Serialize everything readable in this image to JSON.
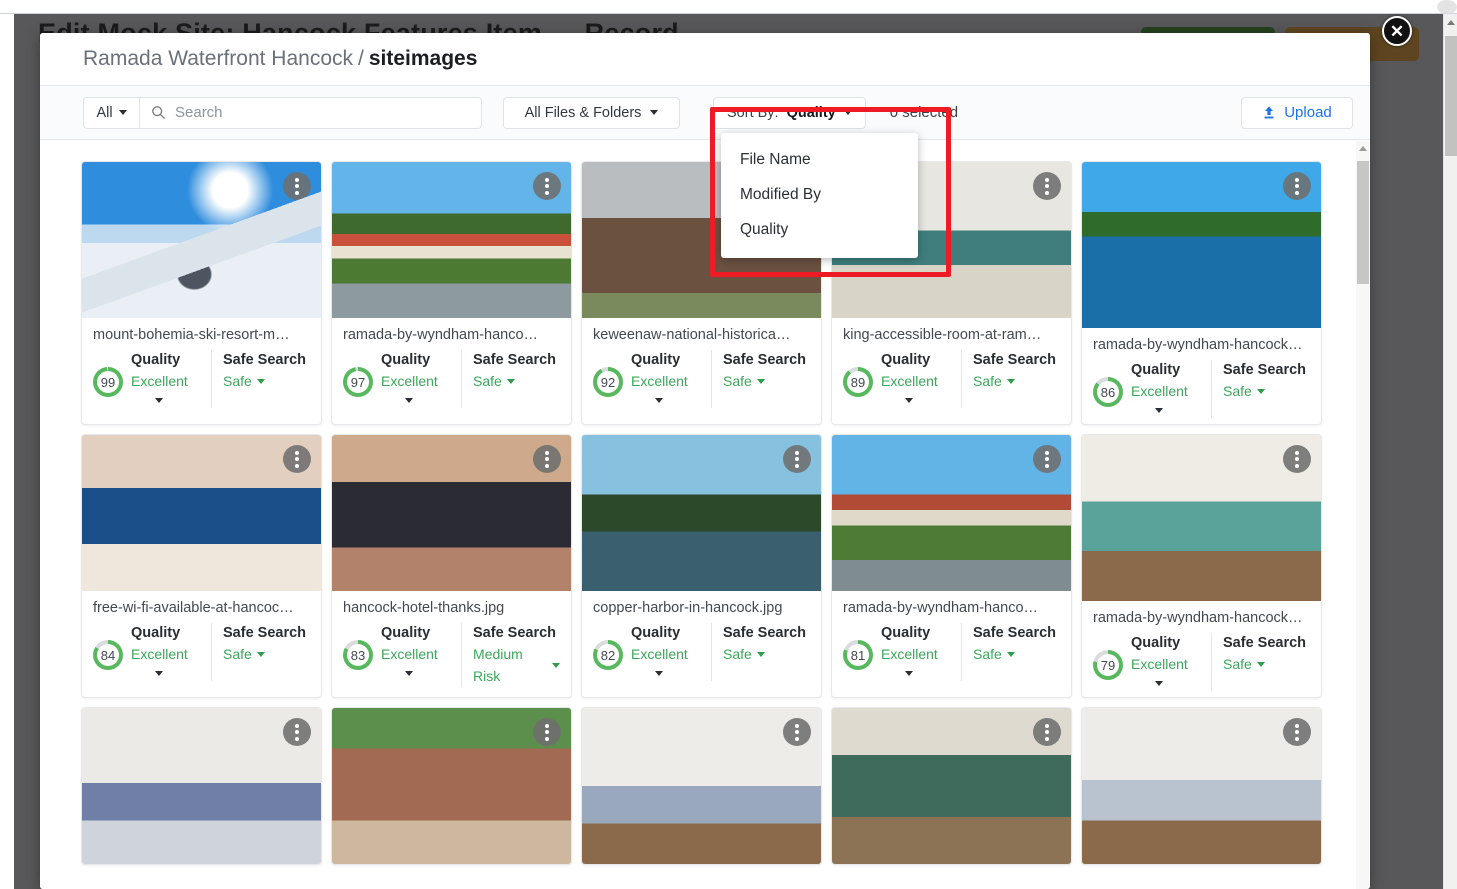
{
  "background": {
    "heading": "Edit Mock Site: Hancock Features Item — Record",
    "buttons": [
      {
        "name": "primary-action",
        "color": "#24421f"
      },
      {
        "name": "secondary-action",
        "color": "#5e4520"
      }
    ]
  },
  "close_button": {
    "glyph": "✕",
    "name": "close-icon"
  },
  "modal": {
    "breadcrumb": {
      "root": "Ramada Waterfront Hancock",
      "separator": "/",
      "current": "siteimages"
    },
    "toolbar": {
      "filter_all": "All",
      "search_placeholder": "Search",
      "search_value": "",
      "files_folders": "All Files & Folders",
      "sort_label": "Sort By:",
      "sort_value": "Quality",
      "selected_count": "0 selected",
      "upload": "Upload"
    },
    "sort_menu": {
      "open": true,
      "items": [
        "File Name",
        "Modified By",
        "Quality"
      ]
    },
    "labels": {
      "quality": "Quality",
      "safe_search": "Safe Search"
    },
    "colors": {
      "ring_fill": "#57b85e",
      "ring_track": "#d9dbde",
      "value_green": "#3aa75a",
      "link_blue": "#1a73e8",
      "annotation_red": "#ee1b24"
    },
    "cards": [
      {
        "filename": "mount-bohemia-ski-resort-m…",
        "quality": 99,
        "quality_label": "Excellent",
        "safe_search": "Safe",
        "art": "ph-ski",
        "tall": false
      },
      {
        "filename": "ramada-by-wyndham-hanco…",
        "quality": 97,
        "quality_label": "Excellent",
        "safe_search": "Safe",
        "art": "ph-hotel1",
        "tall": false
      },
      {
        "filename": "keweenaw-national-historica…",
        "quality": 92,
        "quality_label": "Excellent",
        "safe_search": "Safe",
        "art": "ph-brick",
        "tall": false
      },
      {
        "filename": "king-accessible-room-at-ram…",
        "quality": 89,
        "quality_label": "Excellent",
        "safe_search": "Safe",
        "art": "ph-room1",
        "tall": false
      },
      {
        "filename": "ramada-by-wyndham-hancock…",
        "quality": 86,
        "quality_label": "Excellent",
        "safe_search": "Safe",
        "art": "ph-bridge",
        "tall": true
      },
      {
        "filename": "free-wi-fi-available-at-hancoc…",
        "quality": 84,
        "quality_label": "Excellent",
        "safe_search": "Safe",
        "art": "ph-wifi",
        "tall": false
      },
      {
        "filename": "hancock-hotel-thanks.jpg",
        "quality": 83,
        "quality_label": "Excellent",
        "safe_search": "Medium Risk",
        "art": "ph-hands",
        "tall": false
      },
      {
        "filename": "copper-harbor-in-hancock.jpg",
        "quality": 82,
        "quality_label": "Excellent",
        "safe_search": "Safe",
        "art": "ph-harbor",
        "tall": false
      },
      {
        "filename": "ramada-by-wyndham-hanco…",
        "quality": 81,
        "quality_label": "Excellent",
        "safe_search": "Safe",
        "art": "ph-hotel2",
        "tall": false
      },
      {
        "filename": "ramada-by-wyndham-hancock…",
        "quality": 79,
        "quality_label": "Excellent",
        "safe_search": "Safe",
        "art": "ph-room2",
        "tall": true
      },
      {
        "filename": "",
        "quality": null,
        "quality_label": "",
        "safe_search": "",
        "art": "ph-room3",
        "tall": false,
        "partial": true
      },
      {
        "filename": "",
        "quality": null,
        "quality_label": "",
        "safe_search": "",
        "art": "ph-campus",
        "tall": false,
        "partial": true
      },
      {
        "filename": "",
        "quality": null,
        "quality_label": "",
        "safe_search": "",
        "art": "ph-room4",
        "tall": false,
        "partial": true
      },
      {
        "filename": "",
        "quality": null,
        "quality_label": "",
        "safe_search": "",
        "art": "ph-dining",
        "tall": false,
        "partial": true
      },
      {
        "filename": "",
        "quality": null,
        "quality_label": "",
        "safe_search": "",
        "art": "ph-room5",
        "tall": false,
        "partial": true
      }
    ]
  }
}
